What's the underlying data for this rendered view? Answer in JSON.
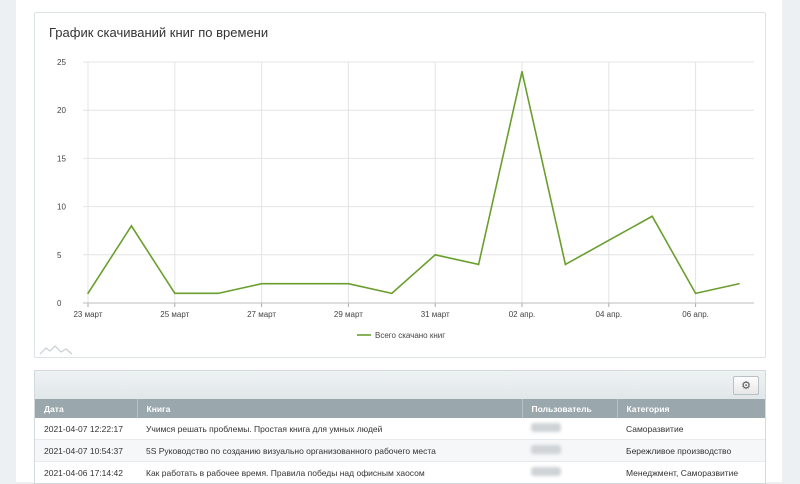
{
  "chart": {
    "title": "График скачиваний книг по времени",
    "legend_label": "Всего скачано книг"
  },
  "chart_data": {
    "type": "line",
    "title": "График скачиваний книг по времени",
    "x": [
      "23 март",
      "24 март",
      "25 март",
      "26 март",
      "27 март",
      "28 март",
      "29 март",
      "30 март",
      "31 март",
      "01 апр.",
      "02 апр.",
      "03 апр.",
      "04 апр.",
      "05 апр.",
      "06 апр.",
      "07 апр."
    ],
    "tick_labels": [
      "23 март",
      "25 март",
      "27 март",
      "29 март",
      "31 март",
      "02 апр.",
      "04 апр.",
      "06 апр."
    ],
    "series": [
      {
        "name": "Всего скачано книг",
        "values": [
          1,
          8,
          1,
          1,
          2,
          2,
          2,
          1,
          5,
          4,
          24,
          4,
          6.5,
          9,
          1,
          2
        ]
      }
    ],
    "ylim": [
      0,
      25
    ],
    "yticks": [
      0,
      5,
      10,
      15,
      20,
      25
    ],
    "grid": true,
    "legend_position": "bottom",
    "color": "#6a9f2e"
  },
  "table": {
    "settings_icon": "gear-icon",
    "headers": [
      "Дата",
      "Книга",
      "Пользователь",
      "Категория"
    ],
    "rows": [
      {
        "date": "2021-04-07 12:22:17",
        "book": "Учимся решать проблемы. Простая книга для умных людей",
        "category": "Саморазвитие"
      },
      {
        "date": "2021-04-07 10:54:37",
        "book": "5S Руководство по созданию визуально организованного рабочего места",
        "category": "Бережливое производство"
      },
      {
        "date": "2021-04-06 17:14:42",
        "book": "Как работать в рабочее время. Правила победы над офисным хаосом",
        "category": "Менеджмент, Саморазвитие"
      }
    ]
  }
}
